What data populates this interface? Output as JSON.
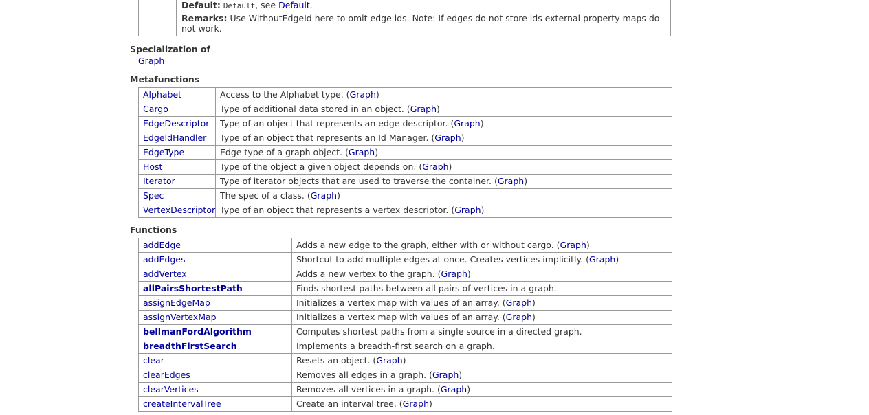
{
  "param": {
    "default_label": "Default:",
    "default_code": "Default",
    "default_sep": ", see ",
    "default_link": "Default",
    "default_end": ".",
    "remarks_label": "Remarks:",
    "remarks_text": "Use WithoutEdgeId here to omit edge ids. Note: If edges do not store ids external property maps do not work."
  },
  "specialization": {
    "title": "Specialization of",
    "link": "Graph"
  },
  "metafunctions": {
    "title": "Metafunctions",
    "rows": [
      {
        "name": "Alphabet",
        "desc": "Access to the Alphabet type. (",
        "ref": "Graph",
        "end": ")"
      },
      {
        "name": "Cargo",
        "desc": "Type of additional data stored in an object. (",
        "ref": "Graph",
        "end": ")"
      },
      {
        "name": "EdgeDescriptor",
        "desc": "Type of an object that represents an edge descriptor. (",
        "ref": "Graph",
        "end": ")"
      },
      {
        "name": "EdgeIdHandler",
        "desc": "Type of an object that represents an Id Manager. (",
        "ref": "Graph",
        "end": ")"
      },
      {
        "name": "EdgeType",
        "desc": "Edge type of a graph object. (",
        "ref": "Graph",
        "end": ")"
      },
      {
        "name": "Host",
        "desc": "Type of the object a given object depends on. (",
        "ref": "Graph",
        "end": ")"
      },
      {
        "name": "Iterator",
        "desc": "Type of iterator objects that are used to traverse the container. (",
        "ref": "Graph",
        "end": ")"
      },
      {
        "name": "Spec",
        "desc": "The spec of a class. (",
        "ref": "Graph",
        "end": ")"
      },
      {
        "name": "VertexDescriptor",
        "desc": "Type of an object that represents a vertex descriptor. (",
        "ref": "Graph",
        "end": ")"
      }
    ]
  },
  "functions": {
    "title": "Functions",
    "rows": [
      {
        "name": "addEdge",
        "desc": "Adds a new edge to the graph, either with or without cargo. (",
        "ref": "Graph",
        "end": ")"
      },
      {
        "name": "addEdges",
        "desc": "Shortcut to add multiple edges at once. Creates vertices implicitly. (",
        "ref": "Graph",
        "end": ")"
      },
      {
        "name": "addVertex",
        "desc": "Adds a new vertex to the graph. (",
        "ref": "Graph",
        "end": ")"
      },
      {
        "name": "allPairsShortestPath",
        "desc": "Finds shortest paths between all pairs of vertices in a graph.",
        "ref": "",
        "end": ""
      },
      {
        "name": "assignEdgeMap",
        "desc": "Initializes a vertex map with values of an array. (",
        "ref": "Graph",
        "end": ")"
      },
      {
        "name": "assignVertexMap",
        "desc": "Initializes a vertex map with values of an array. (",
        "ref": "Graph",
        "end": ")"
      },
      {
        "name": "bellmanFordAlgorithm",
        "desc": "Computes shortest paths from a single source in a directed graph.",
        "ref": "",
        "end": ""
      },
      {
        "name": "breadthFirstSearch",
        "desc": "Implements a breadth-first search on a graph.",
        "ref": "",
        "end": ""
      },
      {
        "name": "clear",
        "desc": "Resets an object. (",
        "ref": "Graph",
        "end": ")"
      },
      {
        "name": "clearEdges",
        "desc": "Removes all edges in a graph. (",
        "ref": "Graph",
        "end": ")"
      },
      {
        "name": "clearVertices",
        "desc": "Removes all vertices in a graph. (",
        "ref": "Graph",
        "end": ")"
      },
      {
        "name": "createIntervalTree",
        "desc": "Create an interval tree. (",
        "ref": "Graph",
        "end": ")"
      }
    ]
  }
}
